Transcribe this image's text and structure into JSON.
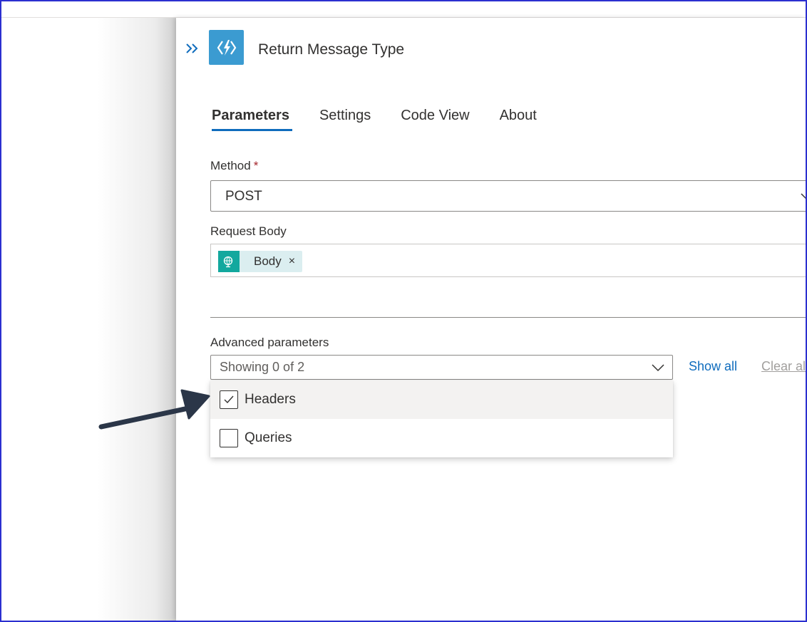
{
  "header": {
    "title": "Return Message Type",
    "collapse_icon": "double-chevron-right-icon",
    "action_icon": "azure-function-icon"
  },
  "tabs": [
    {
      "label": "Parameters",
      "active": true
    },
    {
      "label": "Settings",
      "active": false
    },
    {
      "label": "Code View",
      "active": false
    },
    {
      "label": "About",
      "active": false
    }
  ],
  "method": {
    "label": "Method",
    "required_mark": "*",
    "value": "POST"
  },
  "request_body": {
    "label": "Request Body",
    "token_label": "Body",
    "token_close": "×",
    "token_icon": "trigger-globe-icon"
  },
  "advanced": {
    "label": "Advanced parameters",
    "value": "Showing 0 of 2",
    "show_all": "Show all",
    "clear_all": "Clear all",
    "options": [
      {
        "label": "Headers",
        "checked": true
      },
      {
        "label": "Queries",
        "checked": false
      }
    ]
  },
  "colors": {
    "accent": "#0f6cbd",
    "action_icon_bg": "#3b9bd1",
    "token_icon_bg": "#13a89e",
    "token_bg": "#dbeef0",
    "frame_border": "#2b2fd0",
    "arrow": "#2b3648"
  }
}
